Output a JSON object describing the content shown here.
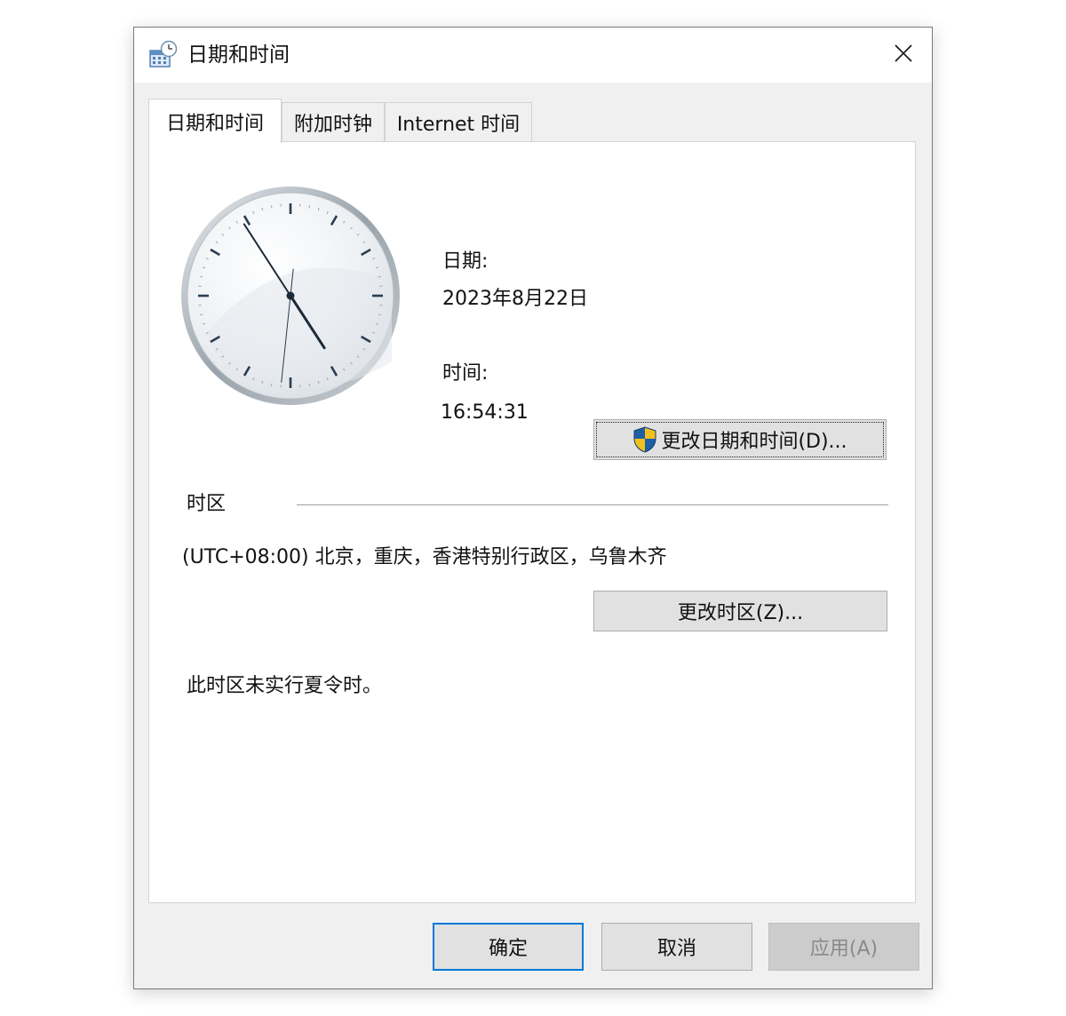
{
  "window": {
    "title": "日期和时间"
  },
  "tabs": [
    {
      "label": "日期和时间",
      "active": true
    },
    {
      "label": "附加时钟",
      "active": false
    },
    {
      "label": "Internet 时间",
      "active": false
    }
  ],
  "date_section": {
    "date_label": "日期:",
    "date_value": "2023年8月22日",
    "time_label": "时间:",
    "time_value": "16:54:31",
    "change_button": "更改日期和时间(D)..."
  },
  "timezone": {
    "heading": "时区",
    "value": "(UTC+08:00) 北京，重庆，香港特别行政区，乌鲁木齐",
    "change_button": "更改时区(Z)...",
    "dst_note": "此时区未实行夏令时。"
  },
  "footer": {
    "ok": "确定",
    "cancel": "取消",
    "apply": "应用(A)"
  },
  "clock": {
    "hour": 16,
    "minute": 54,
    "second": 31
  },
  "icons": {
    "app": "calendar-clock-icon",
    "close": "close-icon",
    "shield": "uac-shield-icon"
  },
  "colors": {
    "accent": "#0078d7",
    "window_bg": "#f0f0f0",
    "panel_bg": "#ffffff"
  }
}
